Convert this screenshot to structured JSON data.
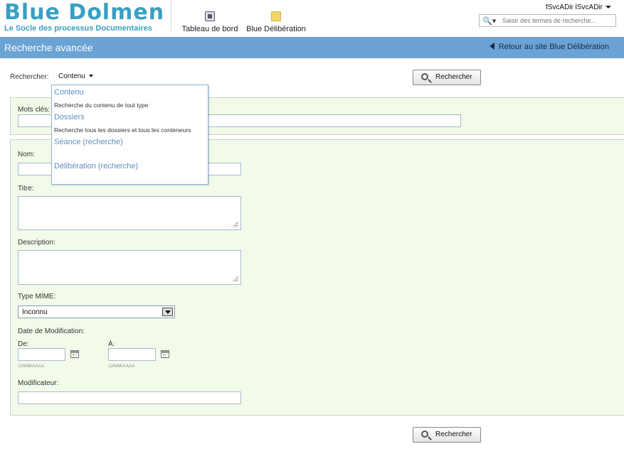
{
  "header": {
    "logo_title": "Blue Dolmen",
    "logo_subtitle": "Le Socle des processus Documentaires",
    "nav": {
      "dashboard": "Tableau de bord",
      "deliberation": "Blue Délibération"
    },
    "user": "fSvcADir lSvcADir",
    "search_placeholder": "Saisir des termes de recherche..."
  },
  "titlebar": {
    "title": "Recherche avancée",
    "back_link": "Retour au site Blue Délibération"
  },
  "search": {
    "label": "Rechercher:",
    "selected_type": "Contenu",
    "button": "Rechercher"
  },
  "dropdown": {
    "options": [
      {
        "label": "Contenu",
        "description": "Recherche du contenu de tout type"
      },
      {
        "label": "Dossiers",
        "description": "Recherche tous les dossiers et tous les conteneurs"
      },
      {
        "label": "Séance (recherche)",
        "description": ""
      },
      {
        "label": "Délibération (recherche)",
        "description": ""
      }
    ]
  },
  "form": {
    "keywords_label": "Mots clés:",
    "name_label": "Nom:",
    "title_label": "Titre:",
    "description_label": "Description:",
    "mime_label": "Type MIME:",
    "mime_value": "Inconnu",
    "date_label": "Date de Modification:",
    "from_label": "De:",
    "to_label": "À:",
    "date_hint": "JJ/MM/AAAA",
    "modifier_label": "Modificateur:"
  },
  "colors": {
    "brand": "#3a9fc0",
    "titlebar": "#6aa3d4",
    "panel": "#f2fbea",
    "link": "#5b8fc4"
  }
}
